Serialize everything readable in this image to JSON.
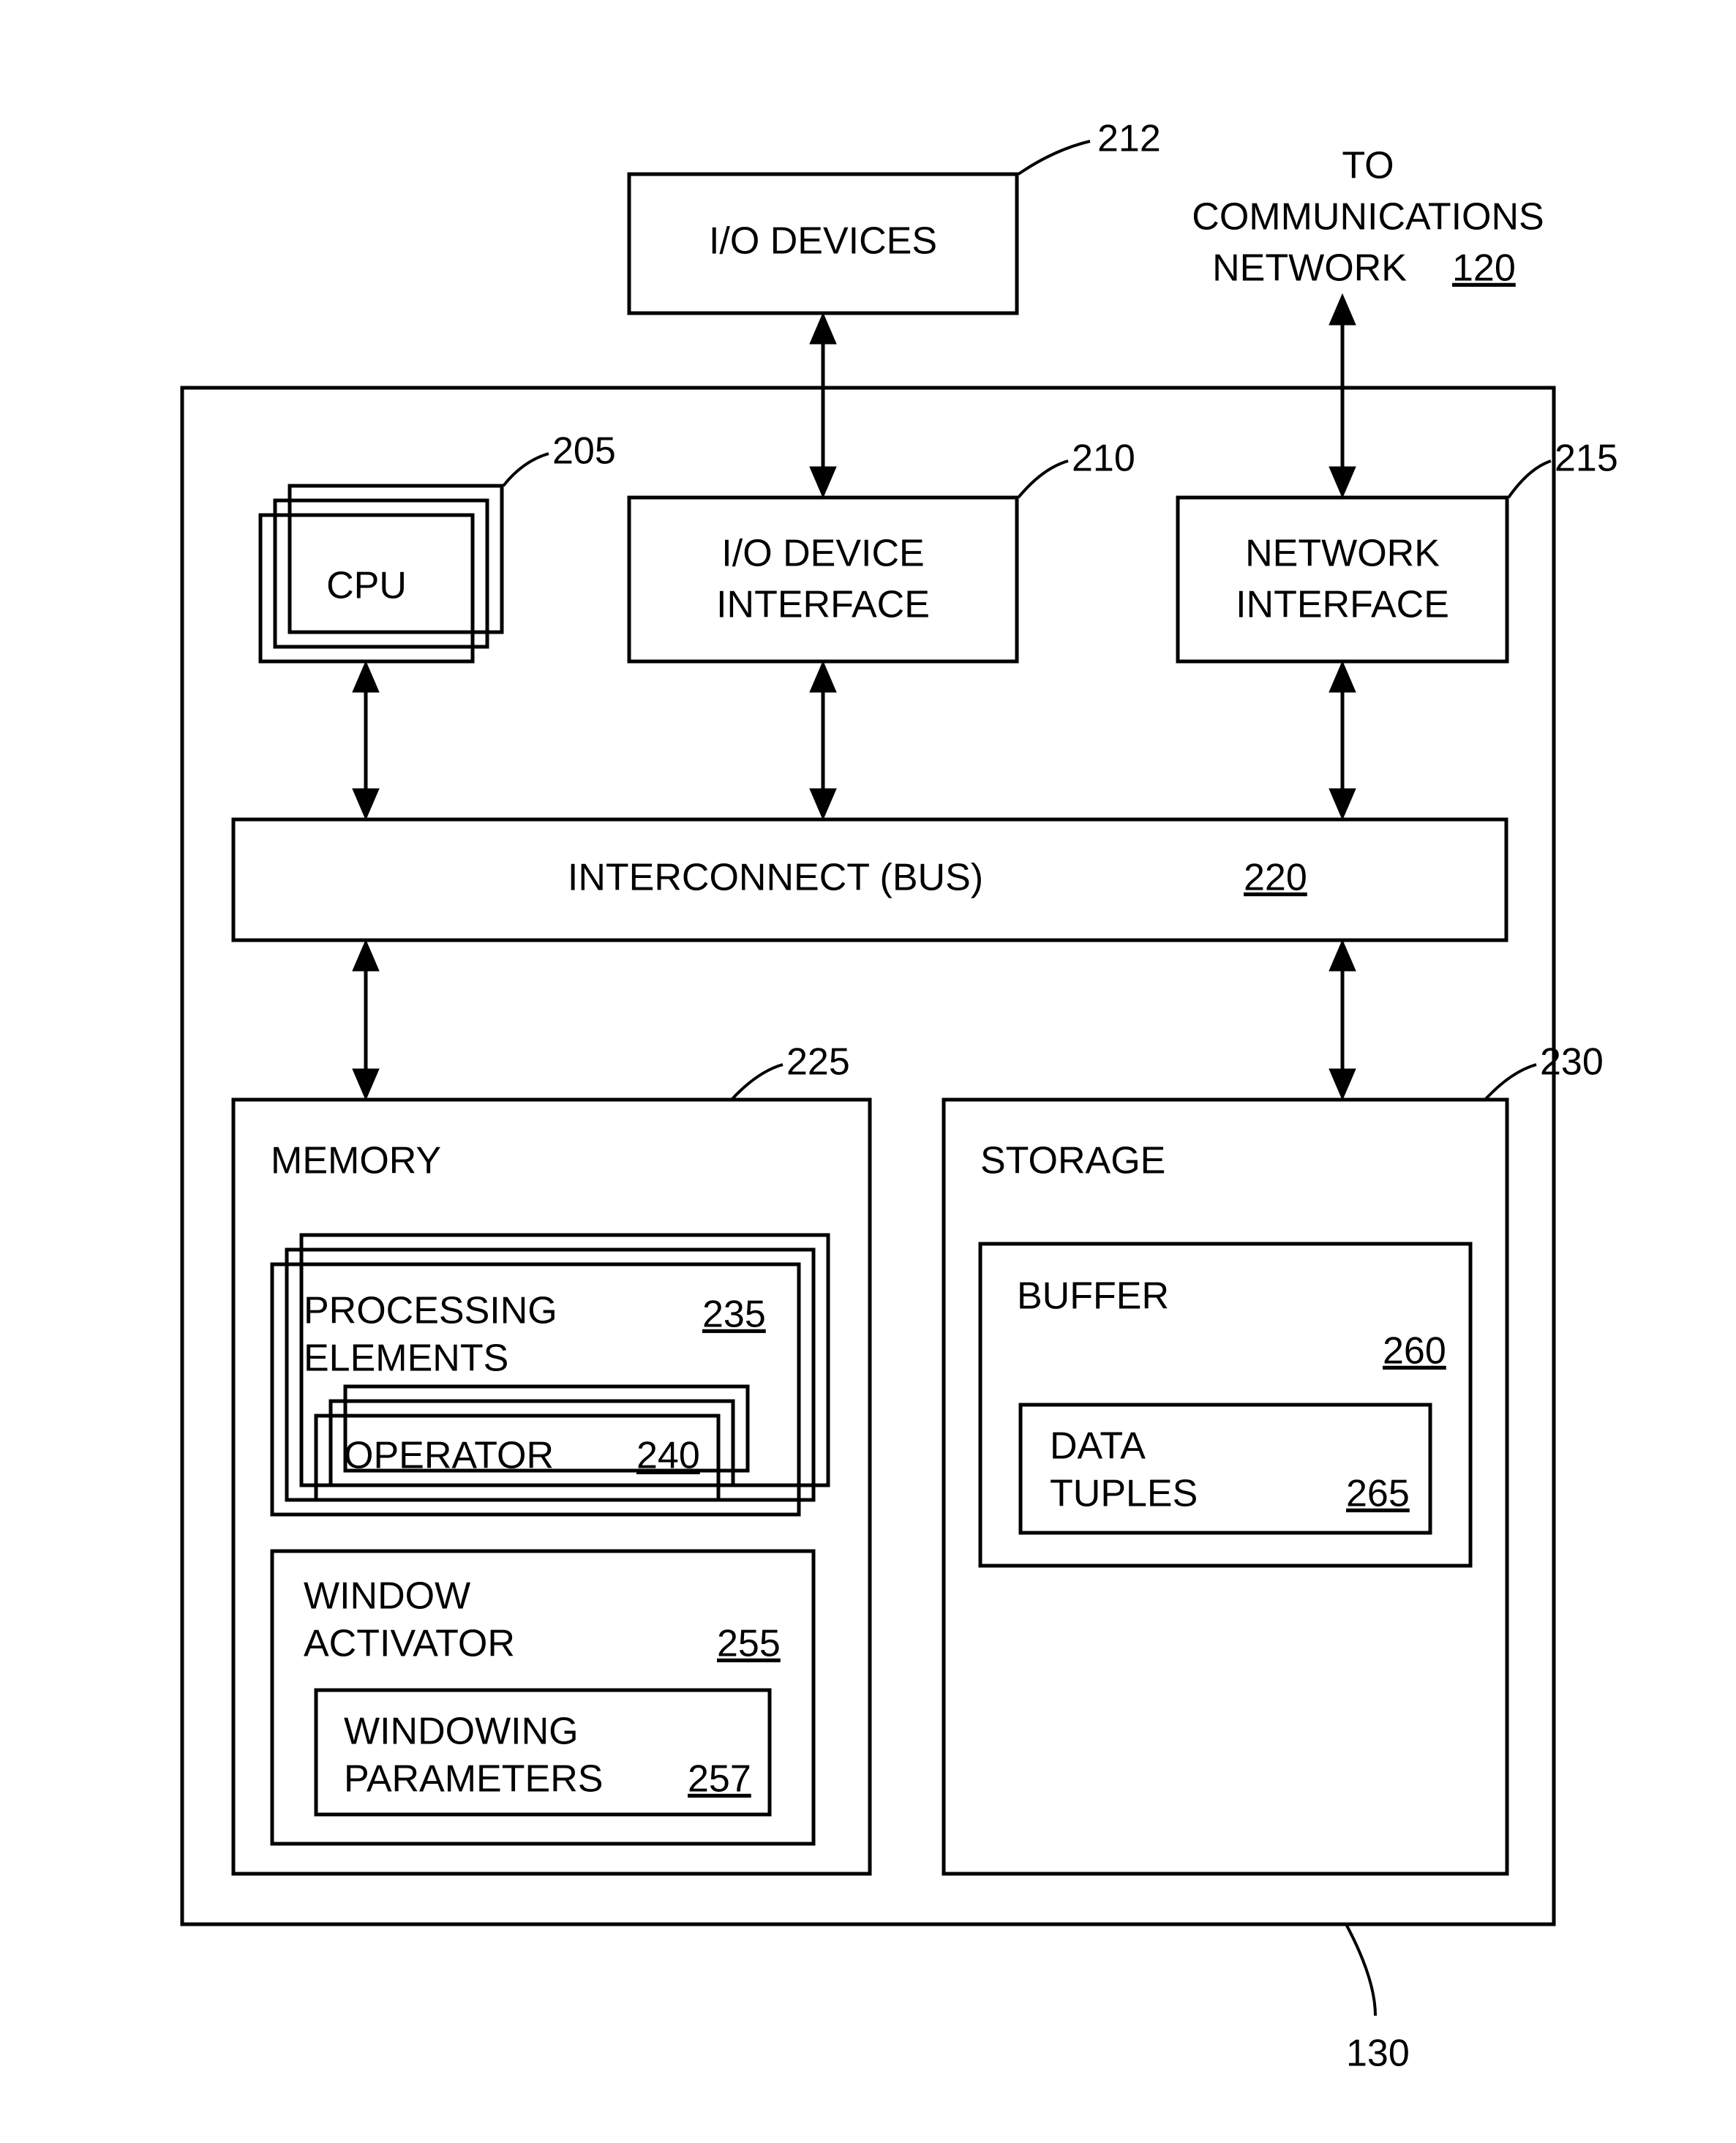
{
  "diagram": {
    "ioDevices": {
      "label": "I/O DEVICES",
      "ref": "212"
    },
    "commNetwork": {
      "line1": "TO",
      "line2": "COMMUNICATIONS",
      "line3": "NETWORK",
      "ref": "120"
    },
    "cpu": {
      "label": "CPU",
      "ref": "205"
    },
    "ioInterface": {
      "line1": "I/O DEVICE",
      "line2": "INTERFACE",
      "ref": "210"
    },
    "netInterface": {
      "line1": "NETWORK",
      "line2": "INTERFACE",
      "ref": "215"
    },
    "interconnect": {
      "label": "INTERCONNECT (BUS)",
      "ref": "220"
    },
    "memory": {
      "label": "MEMORY",
      "ref": "225"
    },
    "procElements": {
      "line1": "PROCESSING",
      "line2": "ELEMENTS",
      "ref": "235"
    },
    "operator": {
      "label": "OPERATOR",
      "ref": "240"
    },
    "windowActivator": {
      "line1": "WINDOW",
      "line2": "ACTIVATOR",
      "ref": "255"
    },
    "windowingParams": {
      "line1": "WINDOWING",
      "line2": "PARAMETERS",
      "ref": "257"
    },
    "storage": {
      "label": "STORAGE",
      "ref": "230"
    },
    "buffer": {
      "label": "BUFFER",
      "ref": "260"
    },
    "dataTuples": {
      "line1": "DATA",
      "line2": "TUPLES",
      "ref": "265"
    },
    "outerRef": "130"
  }
}
